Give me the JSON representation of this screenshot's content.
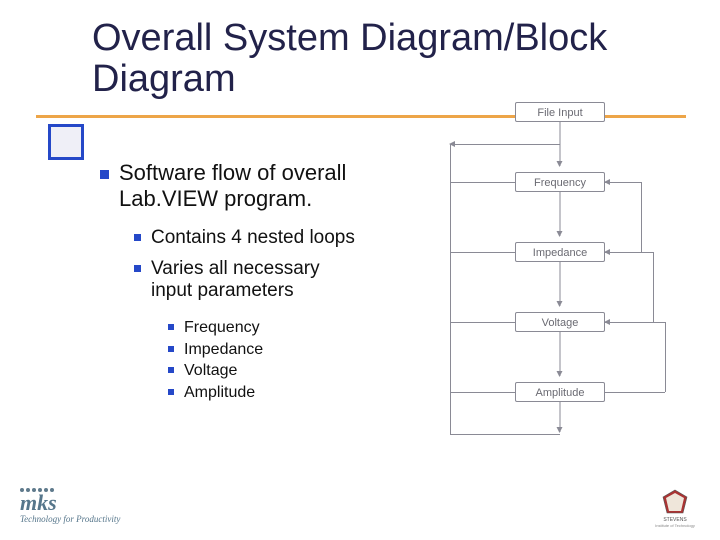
{
  "title": "Overall System Diagram/Block Diagram",
  "bullets": {
    "lvl1": "Software flow of overall Lab.VIEW program.",
    "lvl2": [
      "Contains 4 nested loops",
      "Varies all necessary input parameters"
    ],
    "lvl3": [
      "Frequency",
      "Impedance",
      "Voltage",
      "Amplitude"
    ]
  },
  "flow": {
    "nodes": [
      "File Input",
      "Frequency",
      "Impedance",
      "Voltage",
      "Amplitude"
    ]
  },
  "logos": {
    "mks_text": "mks",
    "mks_tag": "Technology for Productivity",
    "stevens_line1": "STEVENS",
    "stevens_line2": "Institute of Technology"
  }
}
